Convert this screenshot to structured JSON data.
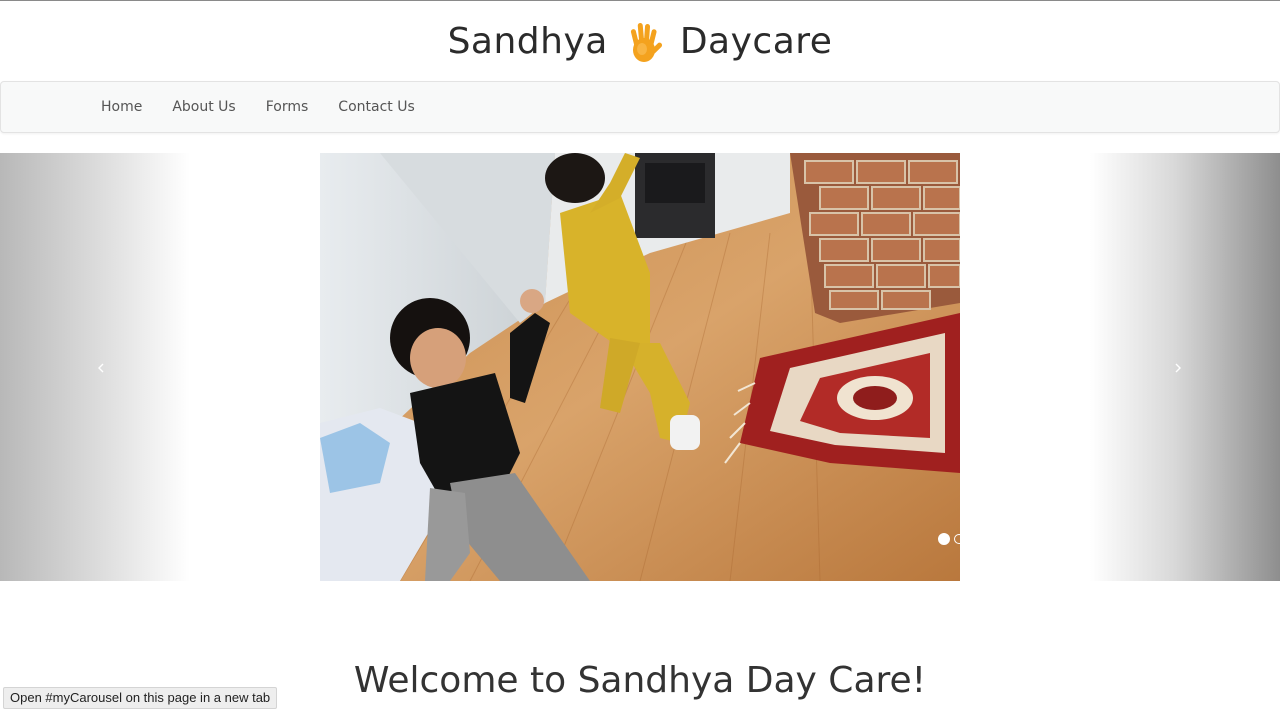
{
  "header": {
    "brand_left": "Sandhya",
    "brand_right": "Daycare",
    "brand_icon": "hand-icon",
    "brand_icon_color": "#f4a21e"
  },
  "nav": {
    "items": [
      {
        "label": "Home"
      },
      {
        "label": "About Us"
      },
      {
        "label": "Forms"
      },
      {
        "label": "Contact Us"
      }
    ]
  },
  "carousel": {
    "prev_icon": "chevron-left-icon",
    "next_icon": "chevron-right-icon",
    "slide_count": 3,
    "active_slide": 1
  },
  "main": {
    "heading": "Welcome to Sandhya Day Care!"
  },
  "status": {
    "text": "Open #myCarousel on this page in a new tab"
  }
}
